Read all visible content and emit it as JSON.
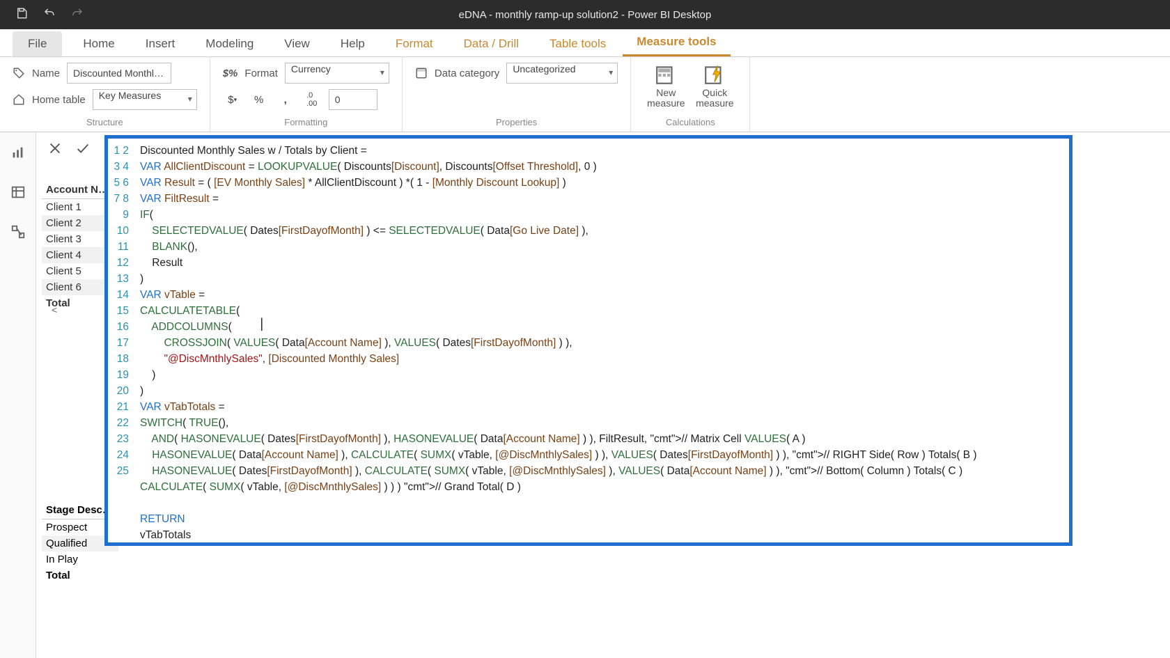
{
  "app": {
    "title": "eDNA - monthly ramp-up solution2 - Power BI Desktop"
  },
  "tabs": {
    "file": "File",
    "items": [
      "Home",
      "Insert",
      "Modeling",
      "View",
      "Help",
      "Format",
      "Data / Drill",
      "Table tools",
      "Measure tools"
    ],
    "active": "Measure tools",
    "contextual_start_index": 5
  },
  "ribbon": {
    "structure": {
      "name_label": "Name",
      "name_value": "Discounted Monthl…",
      "home_table_label": "Home table",
      "home_table_value": "Key Measures",
      "group": "Structure"
    },
    "formatting": {
      "format_label": "Format",
      "format_value": "Currency",
      "decimals_value": "0",
      "group": "Formatting"
    },
    "properties": {
      "category_label": "Data category",
      "category_value": "Uncategorized",
      "group": "Properties"
    },
    "calculations": {
      "new_measure": "New\nmeasure",
      "quick_measure": "Quick\nmeasure",
      "group": "Calculations"
    }
  },
  "visual1": {
    "header": "Account N…",
    "rows": [
      "Client 1",
      "Client 2",
      "Client 3",
      "Client 4",
      "Client 5",
      "Client 6"
    ],
    "total": "Total"
  },
  "visual2": {
    "header": "Stage Desc…",
    "rows": [
      "Prospect",
      "Qualified",
      "In Play"
    ],
    "total": "Total"
  },
  "dax": {
    "lines": [
      "Discounted Monthly Sales w / Totals by Client =",
      "VAR AllClientDiscount = LOOKUPVALUE( Discounts[Discount], Discounts[Offset Threshold], 0 )",
      "VAR Result = ( [EV Monthly Sales] * AllClientDiscount ) *( 1 - [Monthly Discount Lookup] )",
      "VAR FiltResult =",
      "IF(",
      "    SELECTEDVALUE( Dates[FirstDayofMonth] ) <= SELECTEDVALUE( Data[Go Live Date] ),",
      "    BLANK(),",
      "    Result",
      ")",
      "VAR vTable =",
      "CALCULATETABLE(",
      "    ADDCOLUMNS(",
      "        CROSSJOIN( VALUES( Data[Account Name] ), VALUES( Dates[FirstDayofMonth] ) ),",
      "        \"@DiscMnthlySales\", [Discounted Monthly Sales]",
      "    )",
      ")",
      "VAR vTabTotals =",
      "SWITCH( TRUE(),",
      "    AND( HASONEVALUE( Dates[FirstDayofMonth] ), HASONEVALUE( Data[Account Name] ) ), FiltResult, // Matrix Cell VALUES( A )",
      "    HASONEVALUE( Data[Account Name] ), CALCULATE( SUMX( vTable, [@DiscMnthlySales] ) ), VALUES( Dates[FirstDayofMonth] ) ), // RIGHT Side( Row ) Totals( B )",
      "    HASONEVALUE( Dates[FirstDayofMonth] ), CALCULATE( SUMX( vTable, [@DiscMnthlySales] ), VALUES( Data[Account Name] ) ), // Bottom( Column ) Totals( C )",
      "CALCULATE( SUMX( vTable, [@DiscMnthlySales] ) ) ) // Grand Total( D )",
      "",
      "RETURN",
      "vTabTotals"
    ]
  }
}
